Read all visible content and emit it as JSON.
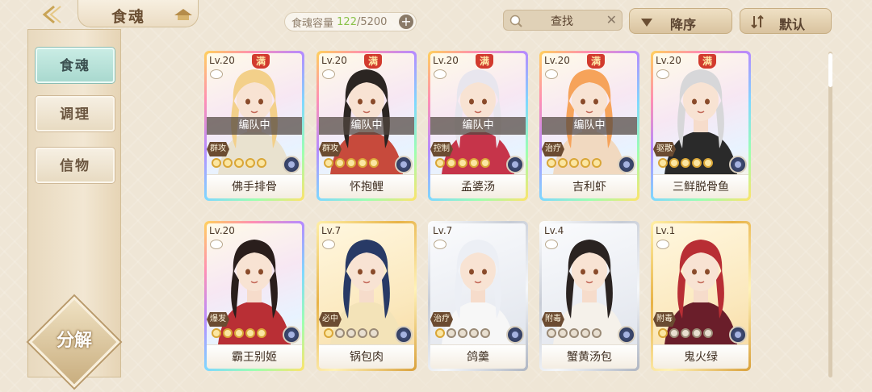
{
  "header": {
    "title": "食魂",
    "capacity_label": "食魂容量",
    "capacity_current": "122",
    "capacity_max": "/5200",
    "capacity_plus": "+",
    "search_label": "查找",
    "search_clear": "✕",
    "sort_order_label": "降序",
    "sort_mode_label": "默认"
  },
  "sidebar": {
    "tabs": [
      "食魂",
      "调理",
      "信物"
    ],
    "active_tab": "食魂",
    "dismantle_label": "分解"
  },
  "cards": [
    {
      "level": "Lv.20",
      "maxed": true,
      "max_label": "满",
      "in_team": true,
      "team_label": "编队中",
      "role": "群攻",
      "stars": 5,
      "name": "佛手排骨",
      "frame": "rainbow",
      "hair": "#f3d08a",
      "outfit": "#e9e2cf"
    },
    {
      "level": "Lv.20",
      "maxed": true,
      "max_label": "满",
      "in_team": true,
      "team_label": "编队中",
      "role": "群攻",
      "stars": 5,
      "name": "怀抱鲤",
      "frame": "rainbow",
      "hair": "#2b2522",
      "outfit": "#c74a3c"
    },
    {
      "level": "Lv.20",
      "maxed": true,
      "max_label": "满",
      "in_team": true,
      "team_label": "编队中",
      "role": "控制",
      "stars": 5,
      "name": "孟婆汤",
      "frame": "rainbow",
      "hair": "#e8e6ee",
      "outfit": "#c6344a"
    },
    {
      "level": "Lv.20",
      "maxed": true,
      "max_label": "满",
      "in_team": true,
      "team_label": "编队中",
      "role": "治疗",
      "stars": 5,
      "name": "吉利虾",
      "frame": "rainbow",
      "hair": "#f6a35a",
      "outfit": "#f1d9c0"
    },
    {
      "level": "Lv.20",
      "maxed": true,
      "max_label": "满",
      "in_team": false,
      "team_label": "",
      "role": "驱散",
      "stars": 5,
      "name": "三鲜脱骨鱼",
      "frame": "rainbow",
      "hair": "#d7d7d9",
      "outfit": "#2a2a2a"
    },
    {
      "level": "Lv.20",
      "maxed": false,
      "max_label": "",
      "in_team": false,
      "team_label": "",
      "role": "爆发",
      "stars": 5,
      "name": "霸王别姬",
      "frame": "rainbow",
      "hair": "#2a1e1c",
      "outfit": "#b92f35"
    },
    {
      "level": "Lv.7",
      "maxed": false,
      "max_label": "",
      "in_team": false,
      "team_label": "",
      "role": "必中",
      "stars": 1,
      "name": "锅包肉",
      "frame": "gold",
      "hair": "#283a66",
      "outfit": "#f3e3b8"
    },
    {
      "level": "Lv.7",
      "maxed": false,
      "max_label": "",
      "in_team": false,
      "team_label": "",
      "role": "治疗",
      "stars": 1,
      "name": "鸽羹",
      "frame": "silver",
      "hair": "#eceff5",
      "outfit": "#f7f7f7"
    },
    {
      "level": "Lv.4",
      "maxed": false,
      "max_label": "",
      "in_team": false,
      "team_label": "",
      "role": "附毒",
      "stars": 0,
      "name": "蟹黄汤包",
      "frame": "silver",
      "hair": "#2a2321",
      "outfit": "#f5f1ea"
    },
    {
      "level": "Lv.1",
      "maxed": false,
      "max_label": "",
      "in_team": false,
      "team_label": "",
      "role": "附毒",
      "stars": 1,
      "name": "鬼火绿",
      "frame": "gold",
      "hair": "#b82e34",
      "outfit": "#6a1e2a"
    }
  ]
}
